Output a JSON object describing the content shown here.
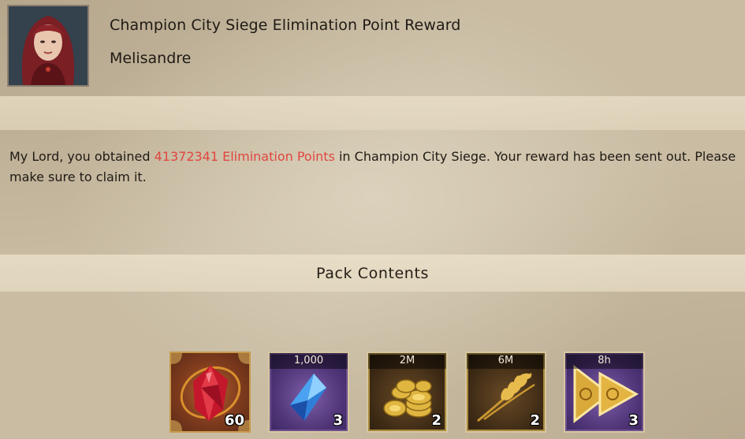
{
  "header": {
    "title": "Champion City Siege Elimination Point Reward",
    "sender": "Melisandre"
  },
  "message": {
    "prefix": "My Lord, you obtained ",
    "highlight": "41372341 Elimination Points",
    "suffix": " in Champion City Siege. Your reward has been sent out. Please make sure to claim it.",
    "highlight_color": "#e0463f"
  },
  "pack": {
    "title": "Pack Contents",
    "items": [
      {
        "icon": "red-gem-icon",
        "top_label": "",
        "count": "60",
        "frame": "orange"
      },
      {
        "icon": "blue-crystal-icon",
        "top_label": "1,000",
        "count": "3",
        "frame": "purple"
      },
      {
        "icon": "gold-coins-icon",
        "top_label": "2M",
        "count": "2",
        "frame": "gold"
      },
      {
        "icon": "wheat-icon",
        "top_label": "6M",
        "count": "2",
        "frame": "gold"
      },
      {
        "icon": "speedup-icon",
        "top_label": "8h",
        "count": "3",
        "frame": "purple"
      }
    ]
  }
}
